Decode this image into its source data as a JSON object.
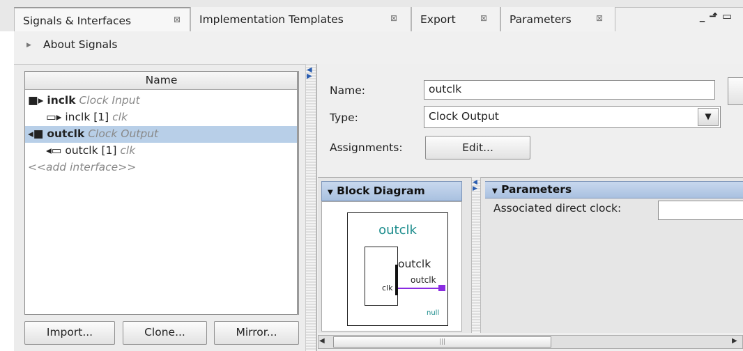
{
  "tabs": [
    {
      "label": "Signals & Interfaces",
      "active": true
    },
    {
      "label": "Implementation Templates",
      "active": false
    },
    {
      "label": "Export",
      "active": false
    },
    {
      "label": "Parameters",
      "active": false
    }
  ],
  "about_label": "About Signals",
  "list": {
    "header": "Name",
    "rows": [
      {
        "name": "inclk",
        "type": "Clock Input",
        "level": 0,
        "icon": "clock-input-icon"
      },
      {
        "name": "inclk [1]",
        "type": "clk",
        "level": 1,
        "icon": "input-port-icon"
      },
      {
        "name": "outclk",
        "type": "Clock Output",
        "level": 0,
        "icon": "clock-output-icon",
        "selected": true
      },
      {
        "name": "outclk [1]",
        "type": "clk",
        "level": 1,
        "icon": "output-port-icon"
      }
    ],
    "add_interface": "<<add interface>>"
  },
  "buttons": {
    "import": "Import...",
    "clone": "Clone...",
    "mirror": "Mirror..."
  },
  "form": {
    "name_label": "Name:",
    "name_value": "outclk",
    "type_label": "Type:",
    "type_value": "Clock Output",
    "assign_label": "Assignments:",
    "edit_label": "Edit..."
  },
  "block_diagram": {
    "header": "Block Diagram",
    "title": "outclk",
    "port_label_big": "outclk",
    "port_label_small": "outclk",
    "clk_label": "clk",
    "null_label": "null"
  },
  "parameters": {
    "header": "Parameters",
    "assoc_label": "Associated direct clock:",
    "assoc_value": ""
  },
  "colors": {
    "selection": "#b8cfe8",
    "teal": "#1b8c8c",
    "purple": "#8a2be2",
    "header_blue": "#a9c1e0"
  }
}
